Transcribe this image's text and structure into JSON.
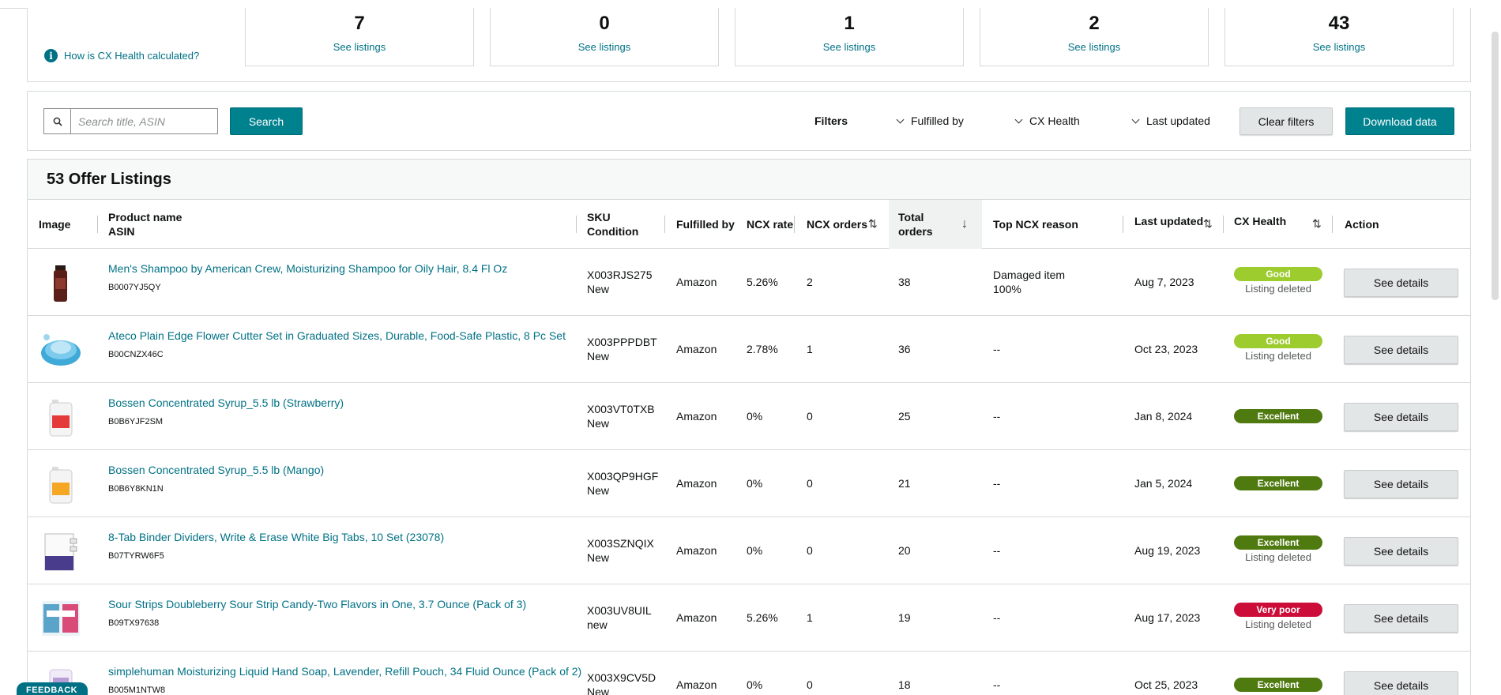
{
  "summary": {
    "help_link": "How is CX Health calculated?",
    "cards": [
      {
        "count": "7",
        "link": "See listings"
      },
      {
        "count": "0",
        "link": "See listings"
      },
      {
        "count": "1",
        "link": "See listings"
      },
      {
        "count": "2",
        "link": "See listings"
      },
      {
        "count": "43",
        "link": "See listings"
      }
    ]
  },
  "toolbar": {
    "search_placeholder": "Search title, ASIN",
    "search_button": "Search",
    "filters_label": "Filters",
    "filter_fulfilled": "Fulfilled by",
    "filter_cx_health": "CX Health",
    "filter_last_updated": "Last updated",
    "clear_filters": "Clear filters",
    "download_data": "Download data"
  },
  "listings": {
    "title": "53 Offer Listings",
    "columns": {
      "image": "Image",
      "product_name": "Product name",
      "asin": "ASIN",
      "sku": "SKU",
      "condition": "Condition",
      "fulfilled_by": "Fulfilled by",
      "ncx_rate": "NCX rate",
      "ncx_orders": "NCX orders",
      "total_orders": "Total orders",
      "top_reason": "Top NCX reason",
      "last_updated": "Last updated",
      "cx_health": "CX Health",
      "action": "Action"
    },
    "rows": [
      {
        "name": "Men's Shampoo by American Crew, Moisturizing Shampoo for Oily Hair, 8.4 Fl Oz",
        "asin": "B0007YJ5QY",
        "sku": "X003RJS275",
        "condition": "New",
        "fulfilled": "Amazon",
        "ncx_rate": "5.26%",
        "ncx_orders": "2",
        "total": "38",
        "reason": "Damaged item",
        "reason_pct": "100%",
        "updated": "Aug 7, 2023",
        "health": "Good",
        "health_color": "#9dcc2f",
        "status": "Listing deleted",
        "action": "See details"
      },
      {
        "name": "Ateco Plain Edge Flower Cutter Set in Graduated Sizes, Durable, Food-Safe Plastic, 8 Pc Set",
        "asin": "B00CNZX46C",
        "sku": "X003PPPDBT",
        "condition": "New",
        "fulfilled": "Amazon",
        "ncx_rate": "2.78%",
        "ncx_orders": "1",
        "total": "36",
        "reason": "--",
        "reason_pct": "",
        "updated": "Oct 23, 2023",
        "health": "Good",
        "health_color": "#9dcc2f",
        "status": "Listing deleted",
        "action": "See details"
      },
      {
        "name": "Bossen Concentrated Syrup_5.5 lb (Strawberry)",
        "asin": "B0B6YJF2SM",
        "sku": "X003VT0TXB",
        "condition": "New",
        "fulfilled": "Amazon",
        "ncx_rate": "0%",
        "ncx_orders": "0",
        "total": "25",
        "reason": "--",
        "reason_pct": "",
        "updated": "Jan 8, 2024",
        "health": "Excellent",
        "health_color": "#4f7a0f",
        "status": "",
        "action": "See details"
      },
      {
        "name": "Bossen Concentrated Syrup_5.5 lb (Mango)",
        "asin": "B0B6Y8KN1N",
        "sku": "X003QP9HGF",
        "condition": "New",
        "fulfilled": "Amazon",
        "ncx_rate": "0%",
        "ncx_orders": "0",
        "total": "21",
        "reason": "--",
        "reason_pct": "",
        "updated": "Jan 5, 2024",
        "health": "Excellent",
        "health_color": "#4f7a0f",
        "status": "",
        "action": "See details"
      },
      {
        "name": "8-Tab Binder Dividers, Write & Erase White Big Tabs, 10 Set (23078)",
        "asin": "B07TYRW6F5",
        "sku": "X003SZNQIX",
        "condition": "New",
        "fulfilled": "Amazon",
        "ncx_rate": "0%",
        "ncx_orders": "0",
        "total": "20",
        "reason": "--",
        "reason_pct": "",
        "updated": "Aug 19, 2023",
        "health": "Excellent",
        "health_color": "#4f7a0f",
        "status": "Listing deleted",
        "action": "See details"
      },
      {
        "name": "Sour Strips Doubleberry Sour Strip Candy-Two Flavors in One, 3.7 Ounce (Pack of 3)",
        "asin": "B09TX97638",
        "sku": "X003UV8UIL",
        "condition": "new",
        "fulfilled": "Amazon",
        "ncx_rate": "5.26%",
        "ncx_orders": "1",
        "total": "19",
        "reason": "--",
        "reason_pct": "",
        "updated": "Aug 17, 2023",
        "health": "Very poor",
        "health_color": "#cc0c39",
        "status": "Listing deleted",
        "action": "See details"
      },
      {
        "name": "simplehuman Moisturizing Liquid Hand Soap, Lavender, Refill Pouch, 34 Fluid Ounce (Pack of 2)",
        "asin": "B005M1NTW8",
        "sku": "X003X9CV5D",
        "condition": "New",
        "fulfilled": "Amazon",
        "ncx_rate": "0%",
        "ncx_orders": "0",
        "total": "18",
        "reason": "--",
        "reason_pct": "",
        "updated": "Oct 25, 2023",
        "health": "Excellent",
        "health_color": "#4f7a0f",
        "status": "",
        "action": "See details"
      }
    ]
  },
  "feedback": "FEEDBACK"
}
